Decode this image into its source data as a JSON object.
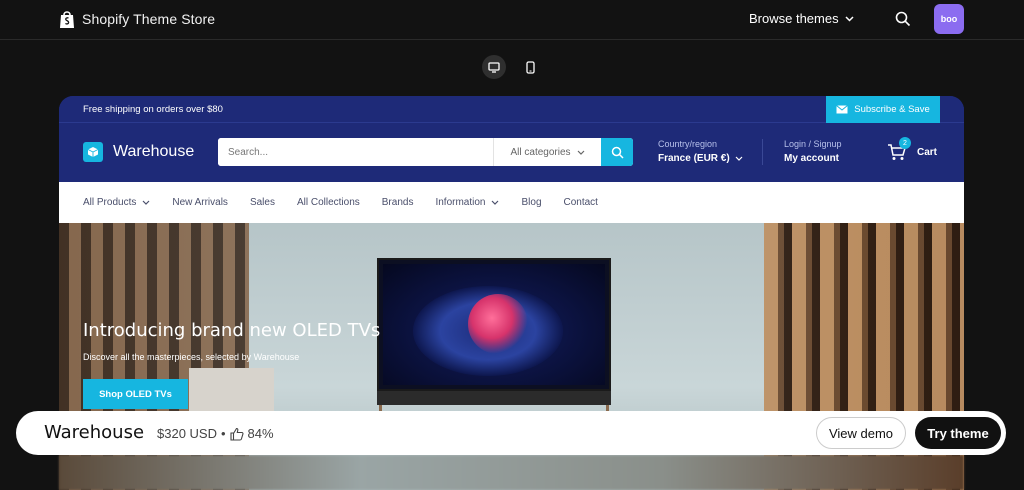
{
  "topbar": {
    "brand": "Shopify Theme Store",
    "browse_label": "Browse themes",
    "avatar_text": "boo"
  },
  "preview": {
    "announcement": "Free shipping on orders over $80",
    "subscribe_label": "Subscribe & Save",
    "logo_text": "Warehouse",
    "search_placeholder": "Search...",
    "category_label": "All categories",
    "country_small": "Country/region",
    "country_value": "France (EUR €)",
    "account_small": "Login / Signup",
    "account_value": "My account",
    "cart_count": "2",
    "cart_label": "Cart",
    "nav": [
      {
        "label": "All Products",
        "dropdown": true
      },
      {
        "label": "New Arrivals",
        "dropdown": false
      },
      {
        "label": "Sales",
        "dropdown": false
      },
      {
        "label": "All Collections",
        "dropdown": false
      },
      {
        "label": "Brands",
        "dropdown": false
      },
      {
        "label": "Information",
        "dropdown": true
      },
      {
        "label": "Blog",
        "dropdown": false
      },
      {
        "label": "Contact",
        "dropdown": false
      }
    ],
    "hero_title": "Introducing brand new OLED TVs",
    "hero_subtitle": "Discover all the masterpieces, selected by Warehouse",
    "hero_button": "Shop OLED TVs"
  },
  "bottombar": {
    "theme_name": "Warehouse",
    "price": "$320 USD",
    "separator": "•",
    "rating": "84%",
    "view_demo": "View demo",
    "try_theme": "Try theme"
  },
  "colors": {
    "accent": "#16b6e0",
    "navy": "#1e2a78",
    "avatar": "#8b6cf0"
  }
}
